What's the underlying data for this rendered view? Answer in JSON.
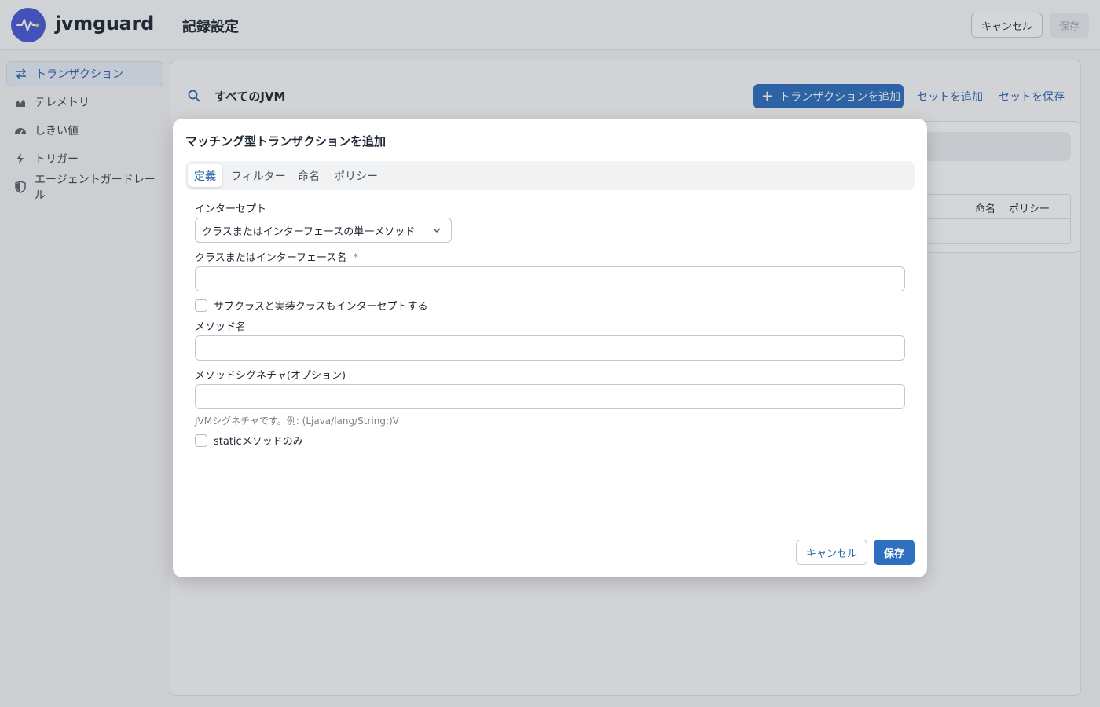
{
  "app": {
    "brand": "jvmguard",
    "page_title": "記録設定"
  },
  "header": {
    "cancel_label": "キャンセル",
    "save_label": "保存"
  },
  "sidebar": {
    "items": [
      {
        "label": "トランザクション",
        "icon": "arrows-icon",
        "active": true
      },
      {
        "label": "テレメトリ",
        "icon": "chart-icon",
        "active": false
      },
      {
        "label": "しきい値",
        "icon": "gauge-icon",
        "active": false
      },
      {
        "label": "トリガー",
        "icon": "bolt-icon",
        "active": false
      },
      {
        "label": "エージェントガードレール",
        "icon": "shield-icon",
        "active": false
      }
    ]
  },
  "main": {
    "scope_label": "すべてのJVM",
    "add_transaction_label": "トランザクションを追加",
    "add_set_label": "セットを追加",
    "save_set_label": "セットを保存",
    "table_headers": [
      "命名",
      "ポリシー"
    ]
  },
  "modal": {
    "title": "マッチング型トランザクションを追加",
    "tabs": [
      {
        "label": "定義",
        "active": true
      },
      {
        "label": "フィルター",
        "active": false
      },
      {
        "label": "命名",
        "active": false
      },
      {
        "label": "ポリシー",
        "active": false
      }
    ],
    "intercept_label": "インターセプト",
    "intercept_value": "クラスまたはインターフェースの単一メソッド",
    "class_name_label": "クラスまたはインターフェース名",
    "required_mark": "*",
    "subclass_checkbox_label": "サブクラスと実装クラスもインターセプトする",
    "method_name_label": "メソッド名",
    "method_signature_label": "メソッドシグネチャ(オプション)",
    "signature_hint": "JVMシグネチャです。例: (Ljava/lang/String;)V",
    "static_checkbox_label": "staticメソッドのみ",
    "cancel_label": "キャンセル",
    "save_label": "保存"
  },
  "colors": {
    "accent": "#2f6fc0",
    "logo": "#4a5bd8"
  }
}
